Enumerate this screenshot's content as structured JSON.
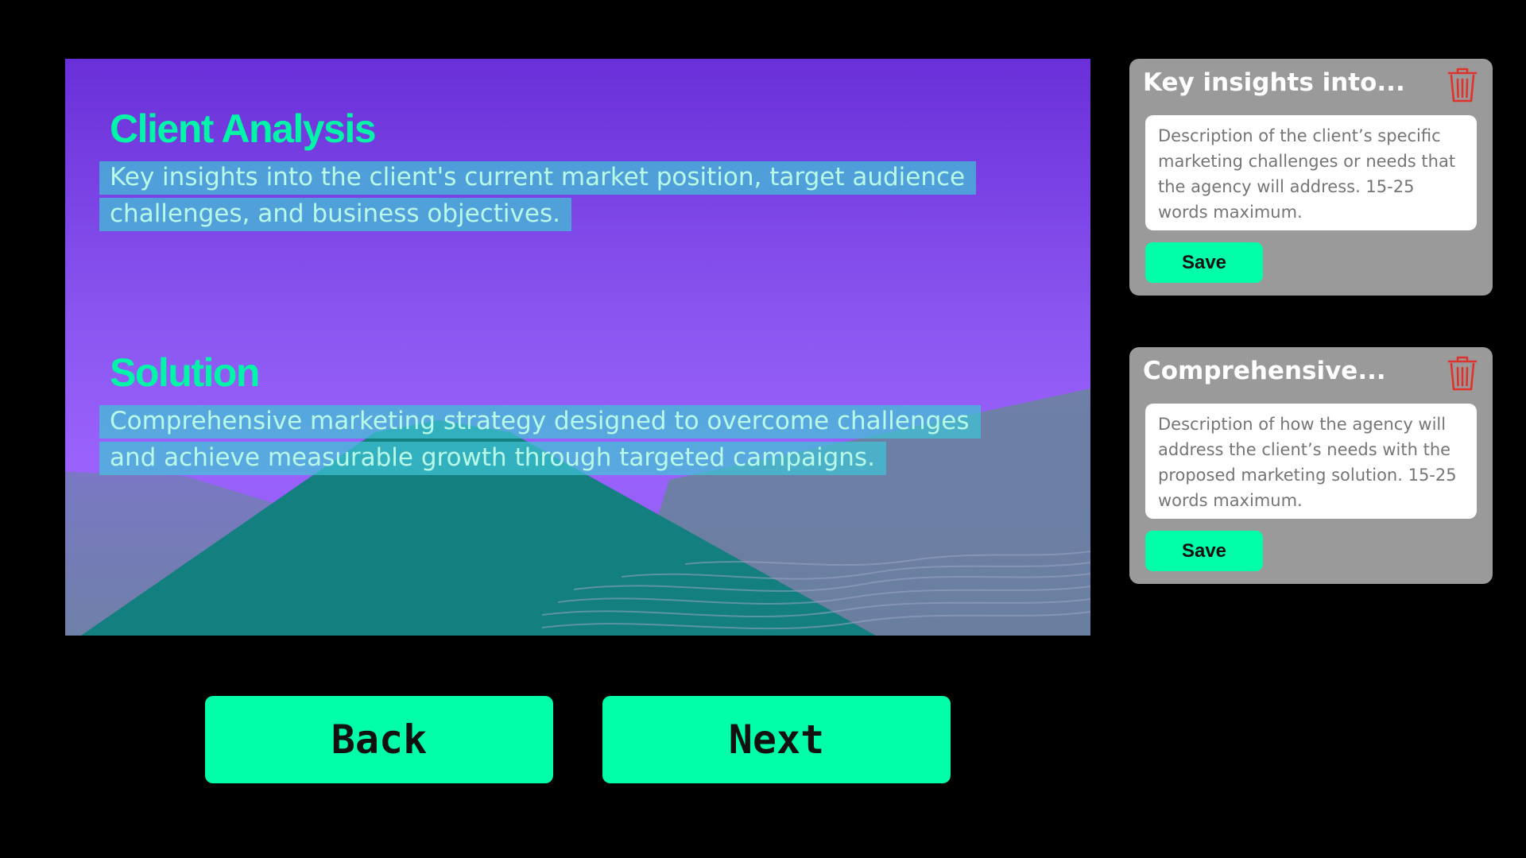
{
  "slide": {
    "sections": [
      {
        "heading": "Client Analysis",
        "body_line1": "Key insights into the client's current market position, target audience",
        "body_line2": "challenges, and business objectives."
      },
      {
        "heading": "Solution",
        "body_line1": "Comprehensive marketing strategy designed to overcome challenges",
        "body_line2": "and achieve measurable growth through targeted campaigns."
      }
    ]
  },
  "nav": {
    "back_label": "Back",
    "next_label": "Next"
  },
  "cards": [
    {
      "title": "Key insights into...",
      "placeholder": "Description of the client’s specific marketing challenges or needs that the agency will address. 15-25 words maximum.",
      "save_label": "Save"
    },
    {
      "title": "Comprehensive...",
      "placeholder": "Description of how the agency will address the client’s needs with the proposed marketing solution. 15-25 words maximum.",
      "save_label": "Save"
    }
  ],
  "icons": {
    "delete": "trash-icon"
  },
  "colors": {
    "accent": "#00ffa8",
    "heading": "#00f5a8",
    "text_highlight": "#40c4d6",
    "card_bg": "#9a9a9a",
    "trash": "#e0322a"
  }
}
